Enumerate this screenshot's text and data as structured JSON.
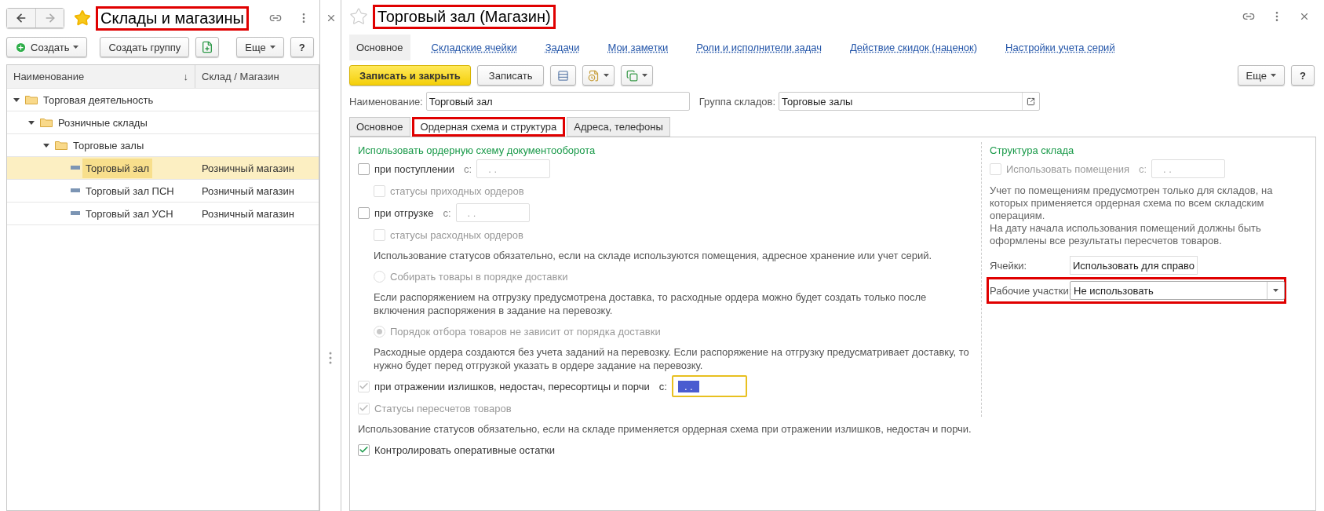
{
  "list_window": {
    "title": "Склады и магазины",
    "title_highlighted": true,
    "starred": true,
    "toolbar": {
      "create": "Создать",
      "create_group": "Создать группу",
      "more": "Еще",
      "help": "?"
    },
    "table": {
      "columns": [
        "Наименование",
        "Склад / Магазин"
      ],
      "sort_mark": "↓",
      "tree": [
        {
          "kind": "group",
          "name": "Торговая деятельность",
          "expanded": true,
          "children": [
            {
              "kind": "group",
              "name": "Розничные склады",
              "expanded": true,
              "children": [
                {
                  "kind": "group",
                  "name": "Торговые залы",
                  "expanded": true,
                  "children": [
                    {
                      "kind": "item",
                      "name": "Торговый зал",
                      "store": "Розничный магазин",
                      "selected": true
                    },
                    {
                      "kind": "item",
                      "name": "Торговый зал ПСН",
                      "store": "Розничный магазин",
                      "selected": false
                    },
                    {
                      "kind": "item",
                      "name": "Торговый зал УСН",
                      "store": "Розничный магазин",
                      "selected": false
                    }
                  ]
                }
              ]
            }
          ]
        }
      ]
    }
  },
  "form_window": {
    "title": "Торговый зал (Магазин)",
    "title_highlighted": true,
    "starred": false,
    "nav": [
      {
        "label": "Основное",
        "selected": true
      },
      {
        "label": "Складские ячейки",
        "selected": false
      },
      {
        "label": "Задачи",
        "selected": false
      },
      {
        "label": "Мои заметки",
        "selected": false
      },
      {
        "label": "Роли и исполнители задач",
        "selected": false
      },
      {
        "label": "Действие скидок (наценок)",
        "selected": false
      },
      {
        "label": "Настройки учета серий",
        "selected": false
      }
    ],
    "toolbar": {
      "save_close": "Записать и закрыть",
      "save": "Записать",
      "more": "Еще",
      "help": "?"
    },
    "name": {
      "label": "Наименование:",
      "value": "Торговый зал"
    },
    "group": {
      "label": "Группа складов:",
      "value": "Торговые залы"
    },
    "tabs": [
      {
        "label": "Основное",
        "selected": false,
        "highlighted": false
      },
      {
        "label": "Ордерная схема и структура",
        "selected": true,
        "highlighted": true
      },
      {
        "label": "Адреса, телефоны",
        "selected": false,
        "highlighted": false
      }
    ],
    "order_scheme": {
      "heading": "Использовать ордерную схему документооборота",
      "items": [
        {
          "kind": "checkbox",
          "label": "при поступлении",
          "checked": false,
          "disabled": false,
          "muted": false,
          "date": {
            "label": "с:",
            "placeholder": ". .",
            "focused": false
          },
          "children": [
            {
              "kind": "checkbox",
              "label": "статусы приходных ордеров",
              "checked": false,
              "disabled": true,
              "muted": true
            }
          ]
        },
        {
          "kind": "checkbox",
          "label": "при отгрузке",
          "checked": false,
          "disabled": false,
          "muted": false,
          "date": {
            "label": "с:",
            "placeholder": ". .",
            "focused": false
          },
          "children": [
            {
              "kind": "checkbox",
              "label": "статусы расходных ордеров",
              "checked": false,
              "disabled": true,
              "muted": true
            },
            {
              "kind": "note",
              "text": "Использование статусов обязательно, если на складе используются помещения, адресное хранение или учет серий."
            },
            {
              "kind": "radio",
              "label": "Собирать товары в порядке доставки",
              "selected": false,
              "disabled": true
            },
            {
              "kind": "note",
              "text": "Если распоряжением на отгрузку предусмотрена доставка, то расходные ордера можно будет создать только после включения распоряжения в задание на перевозку."
            },
            {
              "kind": "radio",
              "label": "Порядок отбора товаров не зависит от порядка доставки",
              "selected": true,
              "disabled": true
            },
            {
              "kind": "note",
              "text": "Расходные ордера создаются без учета заданий на перевозку. Если распоряжение на отгрузку предусматривает доставку, то нужно будет перед отгрузкой указать в ордере задание на перевозку."
            }
          ]
        },
        {
          "kind": "checkbox",
          "label": "при отражении излишков, недостач, пересортицы и порчи",
          "checked": true,
          "disabled": true,
          "muted": false,
          "date": {
            "label": "с:",
            "value": ". .",
            "focused": true
          }
        },
        {
          "kind": "checkbox",
          "label": "Статусы пересчетов товаров",
          "checked": true,
          "disabled": true,
          "muted": true
        },
        {
          "kind": "note",
          "text": "Использование статусов обязательно, если на складе применяется ордерная схема при отражении излишков, недостач и порчи."
        },
        {
          "kind": "checkbox",
          "label": "Контролировать оперативные остатки",
          "checked": true,
          "disabled": false,
          "muted": false
        }
      ]
    },
    "structure": {
      "heading": "Структура склада",
      "rooms": {
        "label": "Использовать помещения",
        "checked": false,
        "disabled": true,
        "date": {
          "label": "с:",
          "placeholder": ". ."
        }
      },
      "notes": [
        "Учет по помещениям предусмотрен только для складов, на которых применяется ордерная схема по всем складским операциям.",
        "На дату начала использования помещений должны быть оформлены все результаты пересчетов товаров."
      ],
      "cells": {
        "label": "Ячейки:",
        "value": "Использовать для справо"
      },
      "work_areas": {
        "label": "Рабочие участки:",
        "value": "Не использовать",
        "highlighted": true
      }
    }
  }
}
